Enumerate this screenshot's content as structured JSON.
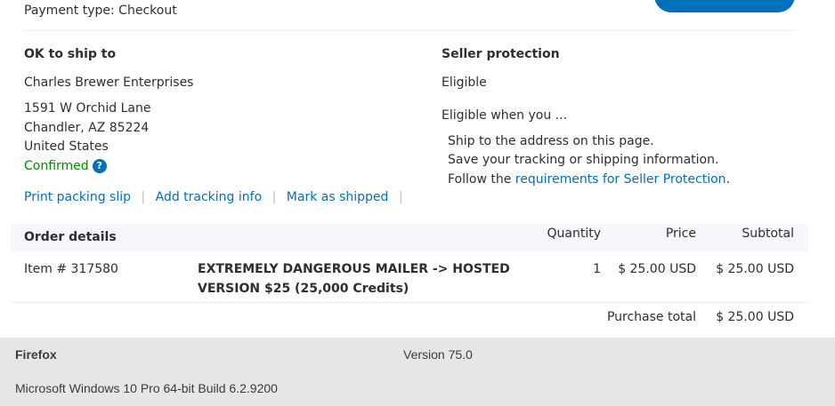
{
  "payment": {
    "type_label": "Payment type: Checkout"
  },
  "ship": {
    "heading": "OK to ship to",
    "name": "Charles Brewer Enterprises",
    "address_line1": "1591 W Orchid Lane",
    "address_line2": "Chandler, AZ 85224",
    "country": "United States",
    "status": "Confirmed",
    "help_glyph": "?"
  },
  "seller_protection": {
    "heading": "Seller protection",
    "status": "Eligible",
    "intro": "Eligible when you ...",
    "item1": "Ship to the address on this page.",
    "item2": "Save your tracking or shipping information.",
    "item3_prefix": "Follow the ",
    "item3_link": "requirements for Seller Protection",
    "item3_suffix": "."
  },
  "actions": {
    "print": "Print packing slip",
    "tracking": "Add tracking info",
    "shipped": "Mark as shipped",
    "separator": "|"
  },
  "order": {
    "heading": "Order details",
    "columns": {
      "quantity": "Quantity",
      "price": "Price",
      "subtotal": "Subtotal"
    },
    "item": {
      "number": "Item # 317580",
      "title_line1": "EXTREMELY DANGEROUS MAILER -> HOSTED",
      "title_line2": "VERSION $25 (25,000 Credits)",
      "quantity": "1",
      "price": "$ 25.00 USD",
      "subtotal": "$ 25.00 USD"
    },
    "total_label": "Purchase total",
    "total_value": "$ 25.00 USD"
  },
  "footer": {
    "browser": "Firefox",
    "version": "Version 75.0",
    "os": "Microsoft Windows 10 Pro 64-bit Build 6.2.9200"
  },
  "colors": {
    "link": "#0070ba",
    "confirmed": "#008a00",
    "footer_bg": "#e6e6e6"
  }
}
